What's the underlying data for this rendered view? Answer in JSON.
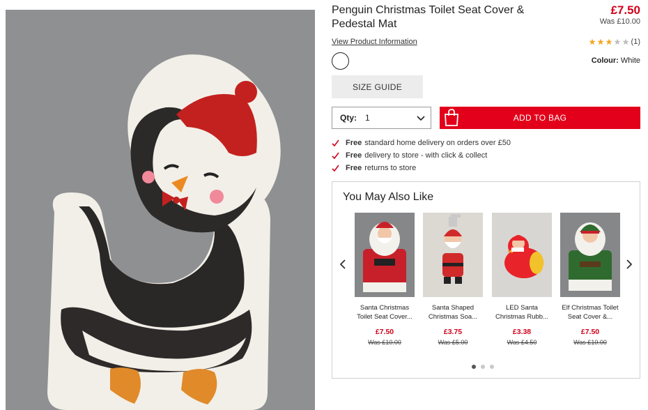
{
  "product": {
    "title": "Penguin Christmas Toilet Seat Cover & Pedestal Mat",
    "price": "£7.50",
    "was_price": "Was £10.00",
    "view_info_label": "View Product Information",
    "rating_count": "(1)",
    "rating_value": 3,
    "rating_max": 5,
    "colour_label": "Colour:",
    "colour_value": "White",
    "image_icon": "penguin-product-image"
  },
  "actions": {
    "size_guide_label": "SIZE GUIDE",
    "qty_label": "Qty:",
    "qty_value": "1",
    "add_to_bag_label": "ADD TO BAG"
  },
  "delivery": [
    {
      "bold": "Free",
      "text": "standard home delivery on orders over £50"
    },
    {
      "bold": "Free",
      "text": "delivery to store - with click & collect"
    },
    {
      "bold": "Free",
      "text": "returns to store"
    }
  ],
  "recommendations": {
    "heading": "You May Also Like",
    "items": [
      {
        "name": "Santa Christmas Toilet Seat Cover...",
        "price": "£7.50",
        "was": "Was £10.00"
      },
      {
        "name": "Santa Shaped Christmas Soa...",
        "price": "£3.75",
        "was": "Was £5.00"
      },
      {
        "name": "LED Santa Christmas Rubb...",
        "price": "£3.38",
        "was": "Was £4.50"
      },
      {
        "name": "Elf Christmas Toilet Seat Cover &...",
        "price": "£7.50",
        "was": "Was £10.00"
      }
    ],
    "active_page": 1,
    "page_count": 3
  },
  "colors": {
    "accent": "#e2001a",
    "price": "#d0021b",
    "star": "#f5a623"
  }
}
